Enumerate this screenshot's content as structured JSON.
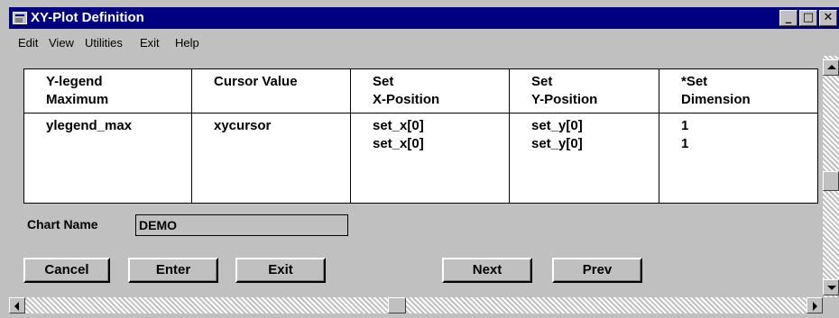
{
  "window": {
    "title": "XY-Plot Definition",
    "controls": {
      "minimize": "_",
      "maximize": "□",
      "close": "✕"
    }
  },
  "menu": [
    {
      "label": "Edit"
    },
    {
      "label": "View"
    },
    {
      "label": "Utilities"
    },
    {
      "label": "Exit"
    },
    {
      "label": "Help"
    }
  ],
  "table": {
    "headers": [
      [
        "Y-legend",
        "Maximum"
      ],
      [
        "Cursor Value"
      ],
      [
        "Set",
        "X-Position"
      ],
      [
        "Set",
        "Y-Position"
      ],
      [
        "*Set",
        "Dimension"
      ]
    ],
    "row": [
      [
        "ylegend_max"
      ],
      [
        "xycursor"
      ],
      [
        "set_x[0]",
        "set_x[0]"
      ],
      [
        "set_y[0]",
        "set_y[0]"
      ],
      [
        "1",
        "1"
      ]
    ]
  },
  "chart_name": {
    "label": "Chart Name",
    "value": "DEMO"
  },
  "buttons": {
    "cancel": "Cancel",
    "enter": "Enter",
    "exit": "Exit",
    "next": "Next",
    "prev": "Prev"
  },
  "colors": {
    "titlebar": "#000080",
    "face": "#c0c0c0"
  }
}
